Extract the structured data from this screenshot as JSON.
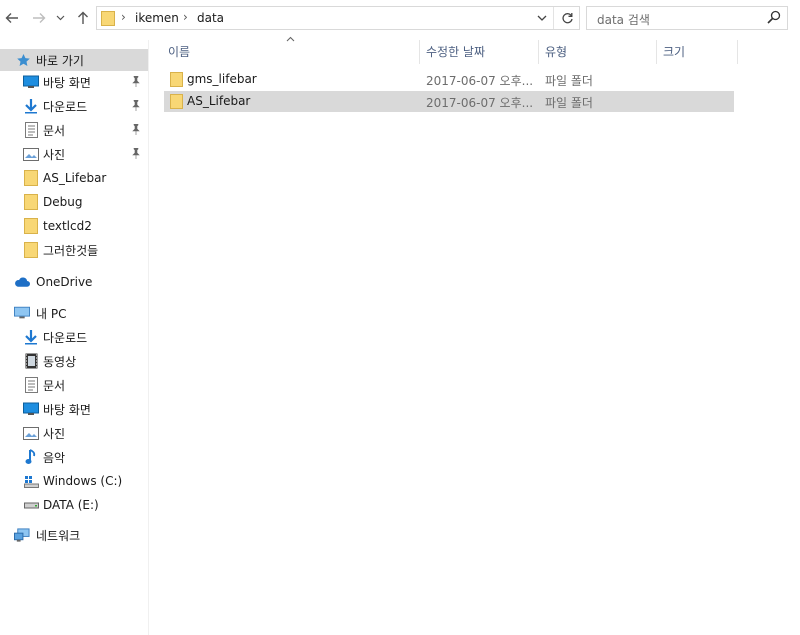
{
  "address": {
    "crumbs": [
      "ikemen",
      "data"
    ],
    "search_placeholder": "data 검색"
  },
  "icons": {
    "back": "arrow-left-icon",
    "forward": "arrow-right-icon",
    "recent": "chevron-down-icon",
    "up": "arrow-up-icon",
    "refresh": "refresh-icon",
    "search": "search-icon"
  },
  "sidebar": {
    "quick_access": "바로 가기",
    "quick_items": [
      {
        "label": "바탕 화면",
        "icon": "desktop-icon",
        "pinned": true
      },
      {
        "label": "다운로드",
        "icon": "download-icon",
        "pinned": true
      },
      {
        "label": "문서",
        "icon": "document-icon",
        "pinned": true
      },
      {
        "label": "사진",
        "icon": "pictures-icon",
        "pinned": true
      },
      {
        "label": "AS_Lifebar",
        "icon": "folder-icon",
        "pinned": false
      },
      {
        "label": "Debug",
        "icon": "folder-icon",
        "pinned": false
      },
      {
        "label": "textlcd2",
        "icon": "folder-icon",
        "pinned": false
      },
      {
        "label": "그러한것들",
        "icon": "folder-icon",
        "pinned": false
      }
    ],
    "onedrive": "OneDrive",
    "this_pc": "내 PC",
    "pc_items": [
      {
        "label": "다운로드",
        "icon": "download-icon"
      },
      {
        "label": "동영상",
        "icon": "video-icon"
      },
      {
        "label": "문서",
        "icon": "document-icon"
      },
      {
        "label": "바탕 화면",
        "icon": "desktop-icon"
      },
      {
        "label": "사진",
        "icon": "pictures-icon"
      },
      {
        "label": "음악",
        "icon": "music-icon"
      },
      {
        "label": "Windows (C:)",
        "icon": "windows-drive-icon"
      },
      {
        "label": "DATA (E:)",
        "icon": "drive-icon"
      }
    ],
    "network": "네트워크"
  },
  "columns": {
    "name": "이름",
    "date": "수정한 날짜",
    "type": "유형",
    "size": "크기"
  },
  "files": [
    {
      "name": "gms_lifebar",
      "date": "2017-06-07 오후...",
      "type": "파일 폴더",
      "selected": false
    },
    {
      "name": "AS_Lifebar",
      "date": "2017-06-07 오후...",
      "type": "파일 폴더",
      "selected": true
    }
  ],
  "colors": {
    "selection": "#d9d9d9",
    "folder": "#f8d775",
    "header_text": "#4d6082",
    "star": "#3b8ed0"
  }
}
